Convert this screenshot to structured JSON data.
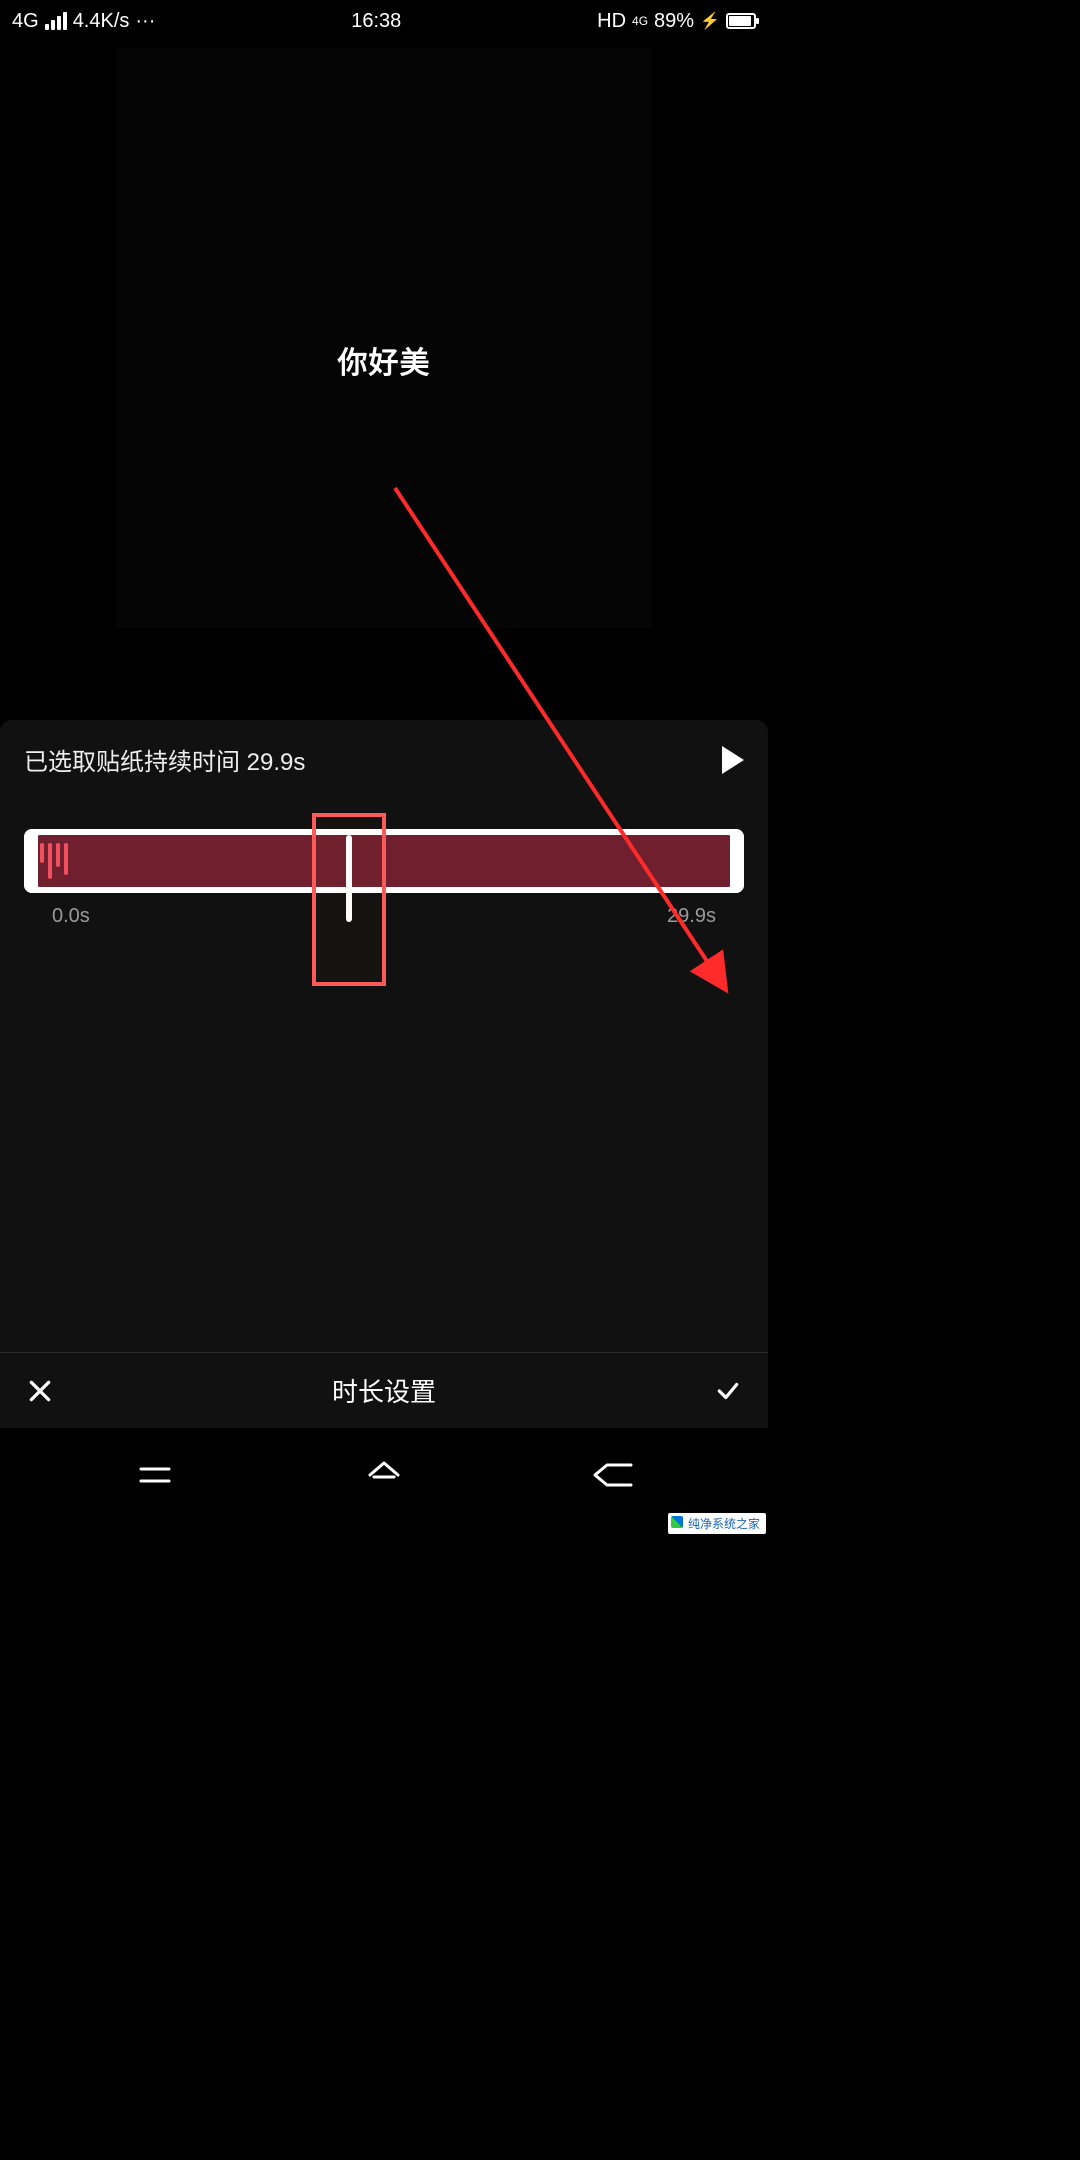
{
  "status_bar": {
    "network_type": "4G",
    "data_rate": "4.4K/s",
    "more": "···",
    "time": "16:38",
    "hd_label": "HD",
    "net_sub": "4G",
    "battery_pct": "89%",
    "charging": "⚡"
  },
  "preview": {
    "sticker_text": "你好美"
  },
  "panel": {
    "duration_label": "已选取贴纸持续时间 29.9s",
    "time_start": "0.0s",
    "time_end": "29.9s"
  },
  "bottom": {
    "title": "时长设置"
  },
  "watermark": {
    "text": "纯净系统之家"
  }
}
